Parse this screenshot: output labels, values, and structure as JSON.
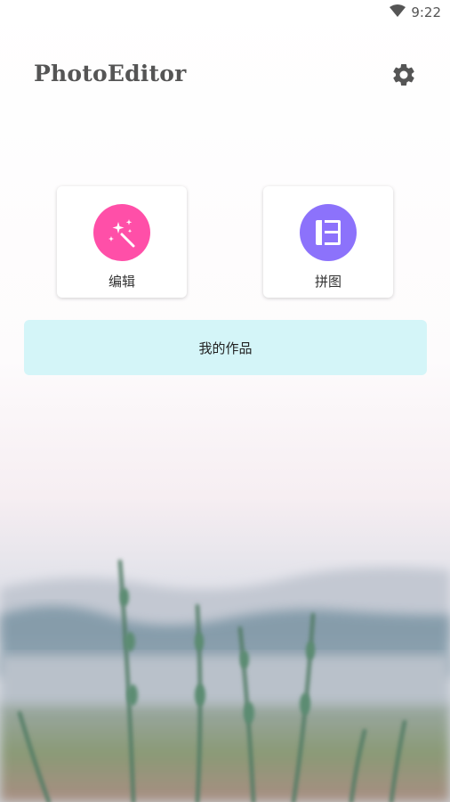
{
  "status_bar": {
    "time": "9:22",
    "wifi_icon": "wifi-icon"
  },
  "header": {
    "title": "PhotoEditor",
    "settings_icon": "gear-icon"
  },
  "actions": [
    {
      "label": "编辑",
      "icon": "magic-wand-icon",
      "color": "#ff4fa8"
    },
    {
      "label": "拼图",
      "icon": "collage-layout-icon",
      "color": "#8c72fb"
    }
  ],
  "my_works": {
    "label": "我的作品",
    "color": "#d4f5f8"
  }
}
